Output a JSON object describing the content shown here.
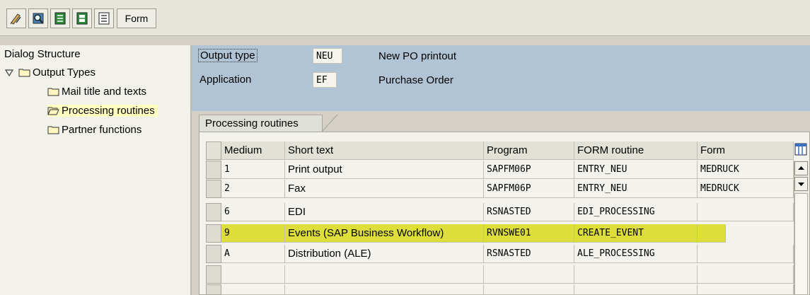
{
  "toolbar": {
    "buttons": [
      {
        "icon": "display-change-icon"
      },
      {
        "icon": "where-used-icon"
      },
      {
        "icon": "select-all-icon"
      },
      {
        "icon": "select-block-icon"
      },
      {
        "icon": "deselect-all-icon"
      }
    ],
    "form_label": "Form"
  },
  "dialog_structure": {
    "title": "Dialog Structure",
    "root": "Output Types",
    "children": [
      "Mail title and texts",
      "Processing routines",
      "Partner functions"
    ],
    "selected_index": 1
  },
  "header": {
    "output_type_label": "Output type",
    "output_type_value": "NEU",
    "output_type_text": "New PO printout",
    "application_label": "Application",
    "application_value": "EF",
    "application_text": "Purchase Order"
  },
  "tab_label": "Processing routines",
  "table": {
    "columns": [
      "Medium",
      "Short text",
      "Program",
      "FORM routine",
      "Form"
    ],
    "rows": [
      {
        "medium": "1",
        "short_text": "Print output",
        "program": "SAPFM06P",
        "form_routine": "ENTRY_NEU",
        "form": "MEDRUCK"
      },
      {
        "medium": "2",
        "short_text": "Fax",
        "program": "SAPFM06P",
        "form_routine": "ENTRY_NEU",
        "form": "MEDRUCK"
      },
      {
        "medium": "6",
        "short_text": "EDI",
        "program": "RSNASTED",
        "form_routine": "EDI_PROCESSING",
        "form": ""
      },
      {
        "medium": "9",
        "short_text": "Events (SAP Business Workflow)",
        "program": "RVNSWE01",
        "form_routine": "CREATE_EVENT",
        "form": ""
      },
      {
        "medium": "A",
        "short_text": "Distribution (ALE)",
        "program": "RSNASTED",
        "form_routine": "ALE_PROCESSING",
        "form": ""
      }
    ],
    "highlighted_row": 3
  },
  "colors": {
    "header_blue": "#b1c4d6",
    "highlight_yellow": "#dede3a",
    "selected_tree_item": "#ffffc0"
  }
}
